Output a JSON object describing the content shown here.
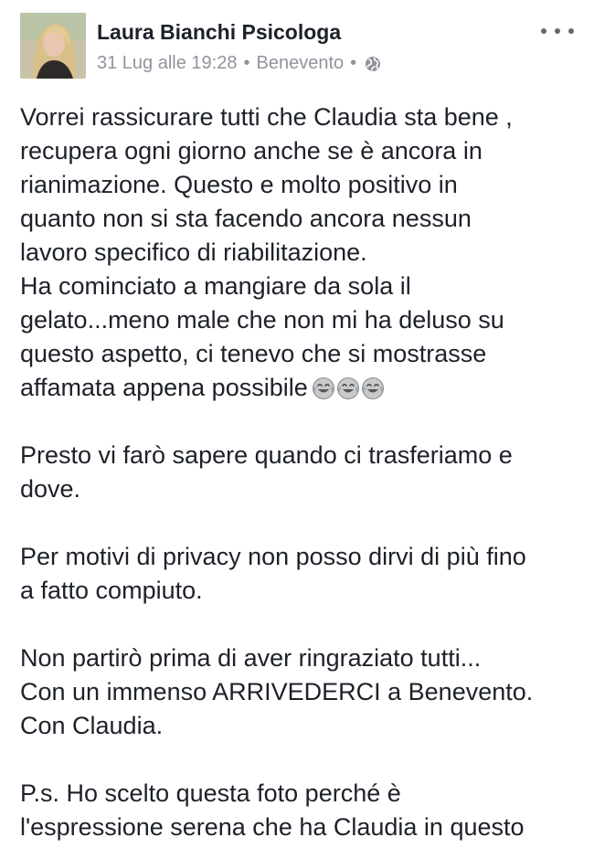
{
  "post": {
    "author": "Laura Bianchi Psicologa",
    "timestamp": "31 Lug alle 19:28",
    "location": "Benevento",
    "separator": "•",
    "privacy_icon": "globe-icon",
    "more_icon": "more-options-icon",
    "avatar_icon": "profile-photo"
  },
  "body": {
    "p1": {
      "l1": "Vorrei rassicurare tutti che Claudia sta bene ,",
      "l2": "recupera ogni giorno anche se è ancora in",
      "l3": "rianimazione. Questo e molto positivo in",
      "l4": "quanto non si sta facendo ancora nessun",
      "l5": "lavoro specifico di riabilitazione.",
      "l6": "Ha cominciato a mangiare da sola il",
      "l7": "gelato...meno male che non mi ha deluso su",
      "l8": "questo aspetto, ci tenevo che si mostrasse",
      "l9": "affamata appena possibile",
      "emoji": "face-with-tears-of-joy-icon"
    },
    "p2": {
      "l1": "Presto vi farò sapere quando ci trasferiamo e",
      "l2": "dove."
    },
    "p3": {
      "l1": "Per motivi di privacy non posso dirvi di più fino",
      "l2": "a fatto compiuto."
    },
    "p4": {
      "l1": "Non partirò prima di aver ringraziato tutti...",
      "l2": "Con un immenso ARRIVEDERCI a Benevento.",
      "l3": "Con Claudia."
    },
    "p5": {
      "l1": "P.s. Ho scelto questa foto perché è",
      "l2": "l'espressione serena che ha Claudia in questo"
    }
  },
  "colors": {
    "text": "#1d2129",
    "meta": "#90949c",
    "icon": "#606770",
    "background": "#ffffff"
  }
}
